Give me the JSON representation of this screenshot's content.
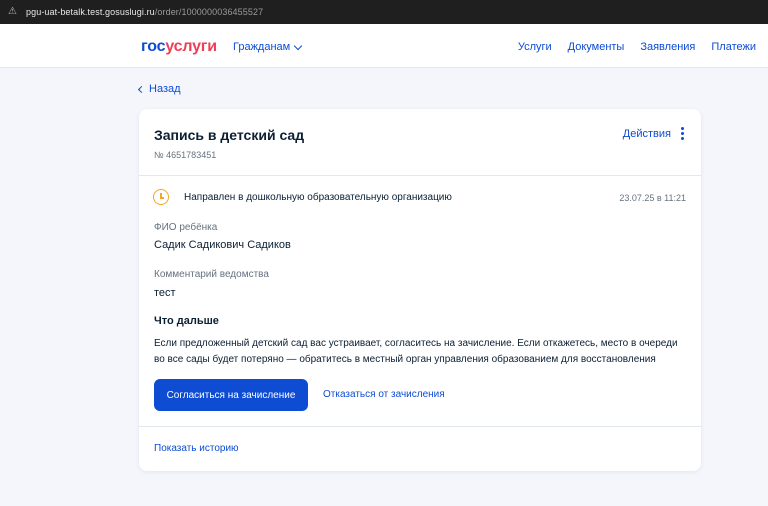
{
  "browser": {
    "url_host": "pgu-uat-betalk.test.gosuslugi.ru",
    "url_path": "/order/1000000036455527",
    "lock_icon": "not-secure-icon"
  },
  "header": {
    "logo_part1": "гос",
    "logo_part2": "услуги",
    "citizens_label": "Гражданам",
    "nav": [
      "Услуги",
      "Документы",
      "Заявления",
      "Платежи"
    ]
  },
  "back_label": "Назад",
  "order": {
    "title": "Запись в детский сад",
    "number": "№ 4651783451",
    "actions_label": "Действия",
    "status": {
      "text": "Направлен в дошкольную образовательную организацию",
      "date": "23.07.25 в 11:21",
      "color": "#f5a623"
    },
    "fields": [
      {
        "label": "ФИО ребёнка",
        "value": "Садик Садикович Садиков"
      },
      {
        "label": "Комментарий ведомства",
        "value": "тест"
      }
    ],
    "next": {
      "title": "Что дальше",
      "text": "Если предложенный детский сад вас устраивает, согласитесь на зачисление. Если откажетесь, место в очереди во все сады будет потеряно — обратитесь в местный орган управления образованием для восстановления"
    },
    "accept_label": "Согласиться на зачисление",
    "decline_label": "Отказаться от зачисления",
    "history_label": "Показать историю"
  },
  "colors": {
    "primary": "#0d4cd3",
    "logo_red": "#ee3f58",
    "background": "#f4f6fb"
  }
}
